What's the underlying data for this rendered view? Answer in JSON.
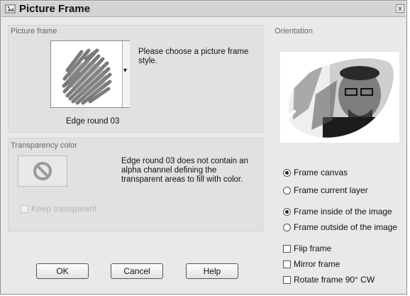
{
  "window": {
    "title": "Picture Frame",
    "close_glyph": "x"
  },
  "picture_frame": {
    "group_label": "Picture frame",
    "hint": "Please choose a picture frame style.",
    "selected_name": "Edge round 03",
    "dropdown_glyph": "▾"
  },
  "transparency": {
    "group_label": "Transparency color",
    "message": "Edge round 03 does not contain an alpha channel defining the transparent areas to fill with color.",
    "keep_transparent_label": "Keep transparent",
    "no_symbol": "⊘"
  },
  "orientation": {
    "group_label": "Orientation",
    "frame_canvas_label": "Frame canvas",
    "frame_current_layer_label": "Frame current layer",
    "frame_inside_label": "Frame inside of the image",
    "frame_outside_label": "Frame outside of the image",
    "flip_frame_label": "Flip frame",
    "mirror_frame_label": "Mirror frame",
    "rotate_frame_label": "Rotate frame 90° CW",
    "frame_canvas_selected": true,
    "frame_inside_selected": true,
    "flip_checked": false,
    "mirror_checked": false,
    "rotate_checked": false
  },
  "buttons": {
    "ok": "OK",
    "cancel": "Cancel",
    "help": "Help"
  }
}
